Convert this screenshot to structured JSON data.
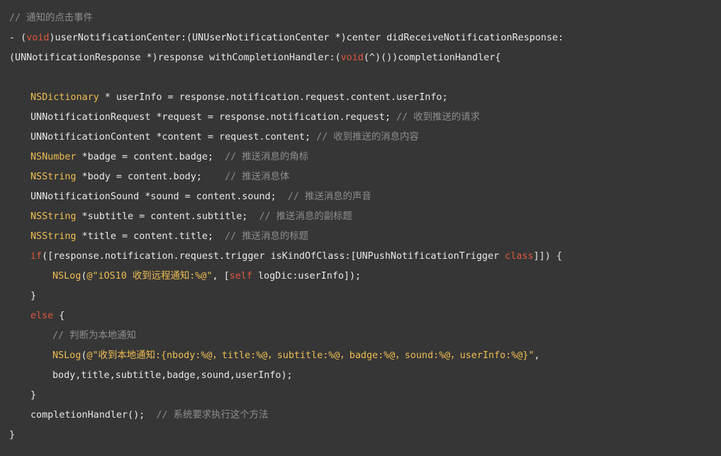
{
  "code_editor": {
    "lines": [
      [
        {
          "t": "comment",
          "v": "// 通知的点击事件"
        }
      ],
      [
        {
          "t": "plain",
          "v": "- ("
        },
        {
          "t": "keyword",
          "v": "void"
        },
        {
          "t": "plain",
          "v": ")userNotificationCenter:(UNUserNotificationCenter *)center didReceiveNotificationResponse:"
        }
      ],
      [
        {
          "t": "plain",
          "v": "(UNNotificationResponse *)response withCompletionHandler:("
        },
        {
          "t": "keyword",
          "v": "void"
        },
        {
          "t": "plain",
          "v": "(^)())completionHandler{"
        }
      ],
      [],
      [
        {
          "t": "type",
          "v": "NSDictionary"
        },
        {
          "t": "plain",
          "v": " * userInfo = response.notification.request.content.userInfo;"
        }
      ],
      [
        {
          "t": "plain",
          "v": "UNNotificationRequest *request = response.notification.request; "
        },
        {
          "t": "comment",
          "v": "// 收到推送的请求"
        }
      ],
      [
        {
          "t": "plain",
          "v": "UNNotificationContent *content = request.content; "
        },
        {
          "t": "comment",
          "v": "// 收到推送的消息内容"
        }
      ],
      [
        {
          "t": "type",
          "v": "NSNumber"
        },
        {
          "t": "plain",
          "v": " *badge = content.badge;  "
        },
        {
          "t": "comment",
          "v": "// 推送消息的角标"
        }
      ],
      [
        {
          "t": "type",
          "v": "NSString"
        },
        {
          "t": "plain",
          "v": " *body = content.body;    "
        },
        {
          "t": "comment",
          "v": "// 推送消息体"
        }
      ],
      [
        {
          "t": "plain",
          "v": "UNNotificationSound *sound = content.sound;  "
        },
        {
          "t": "comment",
          "v": "// 推送消息的声音"
        }
      ],
      [
        {
          "t": "type",
          "v": "NSString"
        },
        {
          "t": "plain",
          "v": " *subtitle = content.subtitle;  "
        },
        {
          "t": "comment",
          "v": "// 推送消息的副标题"
        }
      ],
      [
        {
          "t": "type",
          "v": "NSString"
        },
        {
          "t": "plain",
          "v": " *title = content.title;  "
        },
        {
          "t": "comment",
          "v": "// 推送消息的标题"
        }
      ],
      [
        {
          "t": "keyword",
          "v": "if"
        },
        {
          "t": "plain",
          "v": "([response.notification.request.trigger isKindOfClass:[UNPushNotificationTrigger "
        },
        {
          "t": "keyword",
          "v": "class"
        },
        {
          "t": "plain",
          "v": "]]) {"
        }
      ],
      [
        {
          "t": "type",
          "v": "NSLog"
        },
        {
          "t": "plain",
          "v": "("
        },
        {
          "t": "string",
          "v": "@\"iOS10 收到远程通知:%@\""
        },
        {
          "t": "plain",
          "v": ", ["
        },
        {
          "t": "keyword",
          "v": "self"
        },
        {
          "t": "plain",
          "v": " logDic:userInfo]);"
        }
      ],
      [
        {
          "t": "plain",
          "v": "}"
        }
      ],
      [
        {
          "t": "keyword",
          "v": "else"
        },
        {
          "t": "plain",
          "v": " {"
        }
      ],
      [
        {
          "t": "comment",
          "v": "// 判断为本地通知"
        }
      ],
      [
        {
          "t": "type",
          "v": "NSLog"
        },
        {
          "t": "plain",
          "v": "("
        },
        {
          "t": "string",
          "v": "@\"收到本地通知:{nbody:%@，title:%@，subtitle:%@，badge:%@，sound:%@，userInfo:%@}\""
        },
        {
          "t": "plain",
          "v": ","
        }
      ],
      [
        {
          "t": "plain",
          "v": "body,title,subtitle,badge,sound,userInfo);"
        }
      ],
      [
        {
          "t": "plain",
          "v": "}"
        }
      ],
      [
        {
          "t": "plain",
          "v": "completionHandler();  "
        },
        {
          "t": "comment",
          "v": "// 系统要求执行这个方法"
        }
      ],
      [
        {
          "t": "plain",
          "v": "}"
        }
      ]
    ]
  }
}
